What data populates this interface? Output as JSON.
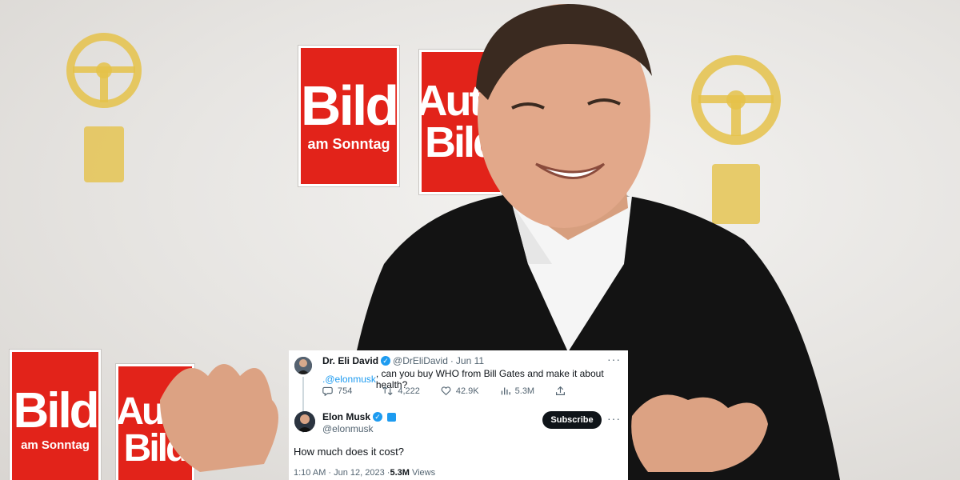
{
  "background": {
    "logos": [
      {
        "big": "Bild",
        "small": "am Sonntag"
      },
      {
        "big": "Auto Bild",
        "small": ""
      },
      {
        "big": "Bild",
        "small": "am Sonntag"
      },
      {
        "big": "Auto Bild",
        "small": ""
      }
    ],
    "colors": {
      "bild_red": "#e2231a",
      "trophy_gold": "#e5c24a",
      "jacket": "#131313",
      "shirt": "#f5f5f5"
    }
  },
  "tweet": {
    "original": {
      "author_name": "Dr. Eli David",
      "handle": "@DrEliDavid",
      "separator": "·",
      "date": "Jun 11",
      "mention": ".@elonmusk",
      "text": ", can you buy WHO from Bill Gates and make it about health?",
      "metrics": {
        "replies": "754",
        "retweets": "4,222",
        "likes": "42.9K",
        "views": "5.3M"
      },
      "more": "···"
    },
    "reply": {
      "author_name": "Elon Musk",
      "handle": "@elonmusk",
      "subscribe_label": "Subscribe",
      "more": "···",
      "text": "How much does it cost?",
      "time": "1:10 AM · Jun 12, 2023 · ",
      "views_count": "5.3M",
      "views_label": "Views"
    },
    "colors": {
      "accent": "#1d9bf0",
      "text": "#0f1419",
      "muted": "#536471"
    }
  }
}
